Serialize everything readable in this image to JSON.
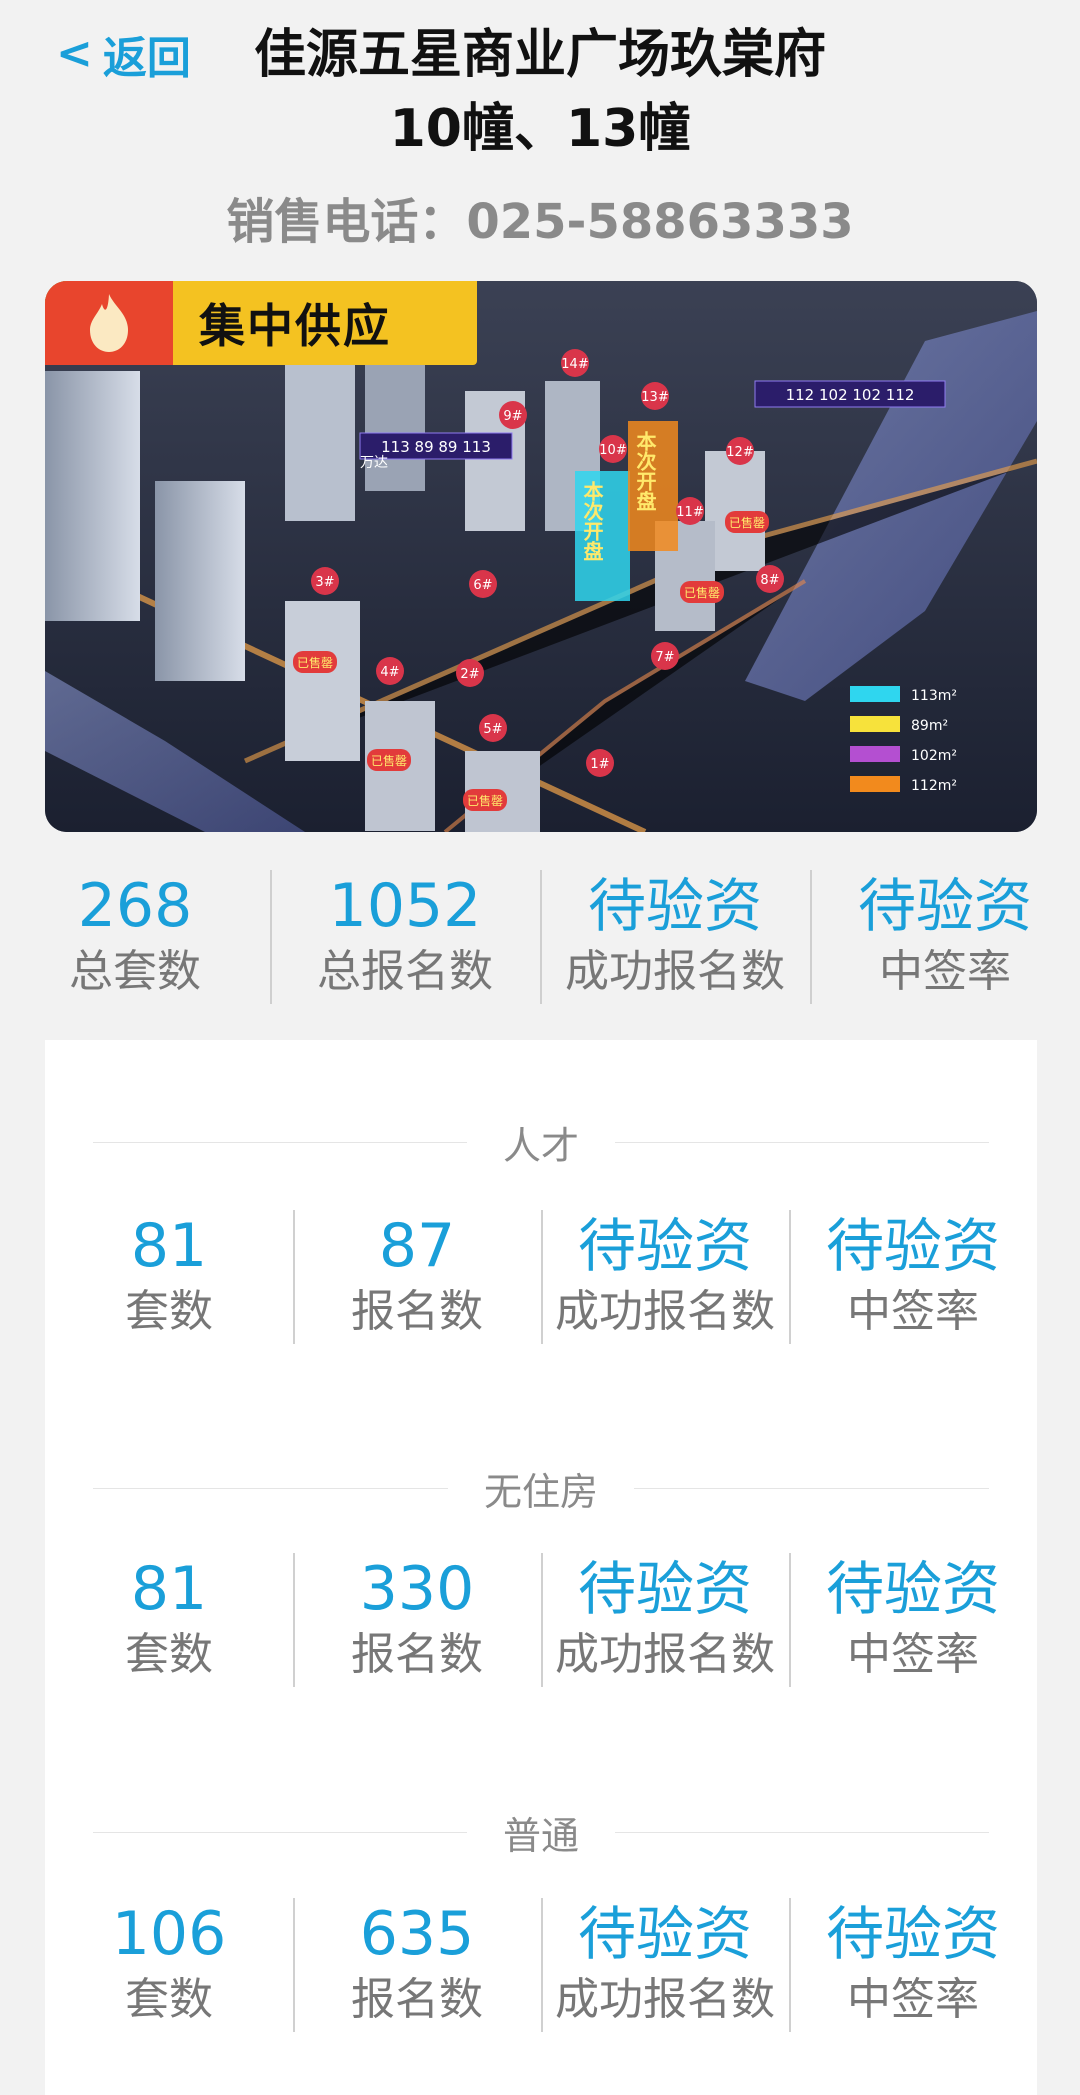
{
  "header": {
    "back_label": "返回",
    "title_line1": "佳源五星商业广场玖棠府",
    "title_line2": "10幢、13幢",
    "phone": "销售电话：025-58863333"
  },
  "hero": {
    "badge": "集中供应",
    "plan_label_left": "113 89 89 113",
    "plan_label_right": "112 102 102 112",
    "open_tag": "本次开盘",
    "sold_tag": "已售罄",
    "landmark": "万达",
    "buildings": [
      "14#",
      "13#",
      "12#",
      "11#",
      "10#",
      "9#",
      "8#",
      "7#",
      "6#",
      "5#",
      "4#",
      "3#",
      "2#",
      "1#"
    ],
    "legend": [
      {
        "label": "113m²",
        "color": "#2fd6ef"
      },
      {
        "label": "89m²",
        "color": "#f7e23b"
      },
      {
        "label": "102m²",
        "color": "#b44fd1"
      },
      {
        "label": "112m²",
        "color": "#f28a1d"
      }
    ]
  },
  "summary": [
    {
      "value": "268",
      "label": "总套数"
    },
    {
      "value": "1052",
      "label": "总报名数"
    },
    {
      "value": "待验资",
      "label": "成功报名数"
    },
    {
      "value": "待验资",
      "label": "中签率"
    }
  ],
  "sections": [
    {
      "title": "人才",
      "cells": [
        {
          "value": "81",
          "label": "套数"
        },
        {
          "value": "87",
          "label": "报名数"
        },
        {
          "value": "待验资",
          "label": "成功报名数"
        },
        {
          "value": "待验资",
          "label": "中签率"
        }
      ]
    },
    {
      "title": "无住房",
      "cells": [
        {
          "value": "81",
          "label": "套数"
        },
        {
          "value": "330",
          "label": "报名数"
        },
        {
          "value": "待验资",
          "label": "成功报名数"
        },
        {
          "value": "待验资",
          "label": "中签率"
        }
      ]
    },
    {
      "title": "普通",
      "cells": [
        {
          "value": "106",
          "label": "套数"
        },
        {
          "value": "635",
          "label": "报名数"
        },
        {
          "value": "待验资",
          "label": "成功报名数"
        },
        {
          "value": "待验资",
          "label": "中签率"
        }
      ]
    }
  ],
  "colors": {
    "accent": "#1a9fd9",
    "background": "#f2f2f2",
    "badge": "#f4c221"
  }
}
